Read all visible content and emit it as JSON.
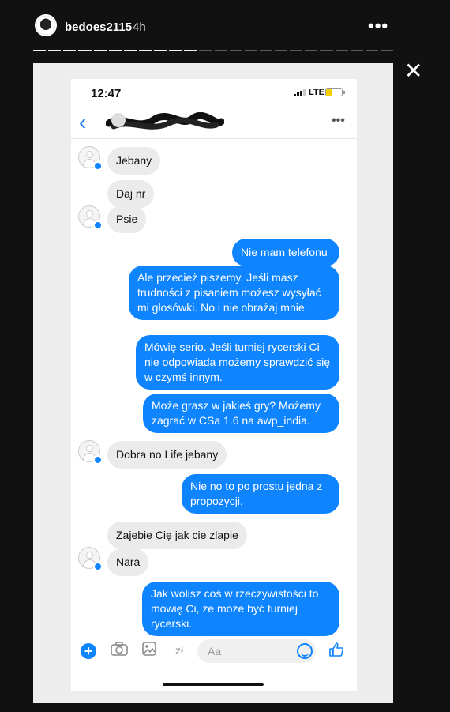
{
  "story": {
    "username": "bedoes2115",
    "time_ago": "4h",
    "progress_segments": 24,
    "progress_done": 11
  },
  "phone": {
    "status": {
      "time": "12:47",
      "network": "LTE"
    }
  },
  "chat": {
    "messages": [
      {
        "side": "left",
        "text": "Jebany"
      },
      {
        "side": "left",
        "text": "Daj nr"
      },
      {
        "side": "left",
        "text": "Psie"
      },
      {
        "side": "right",
        "text": "Nie mam telefonu"
      },
      {
        "side": "right",
        "text": "Ale przecież piszemy. Jeśli masz trudności z pisaniem możesz wysyłać mi głosówki. No i nie obrażaj mnie."
      },
      {
        "side": "right",
        "text": "Mówię serio. Jeśli turniej rycerski Ci nie odpowiada możemy sprawdzić się w czymś innym."
      },
      {
        "side": "right",
        "text": "Może grasz w jakieś gry? Możemy zagrać w CSa 1.6 na awp_india."
      },
      {
        "side": "left",
        "text": "Dobra no Life jebany"
      },
      {
        "side": "right",
        "text": "Nie no to po prostu jedna z propozycji."
      },
      {
        "side": "left",
        "text": "Zajebie Cię jak cie zlapie"
      },
      {
        "side": "left",
        "text": "Nara"
      },
      {
        "side": "right",
        "text": "Jak wolisz coś w rzeczywistości to mówię Ci, że może być turniej rycerski."
      }
    ]
  },
  "input_bar": {
    "currency_label": "zł",
    "placeholder": "Aa"
  },
  "colors": {
    "accent": "#0f84ff",
    "incoming": "#ebebeb"
  }
}
